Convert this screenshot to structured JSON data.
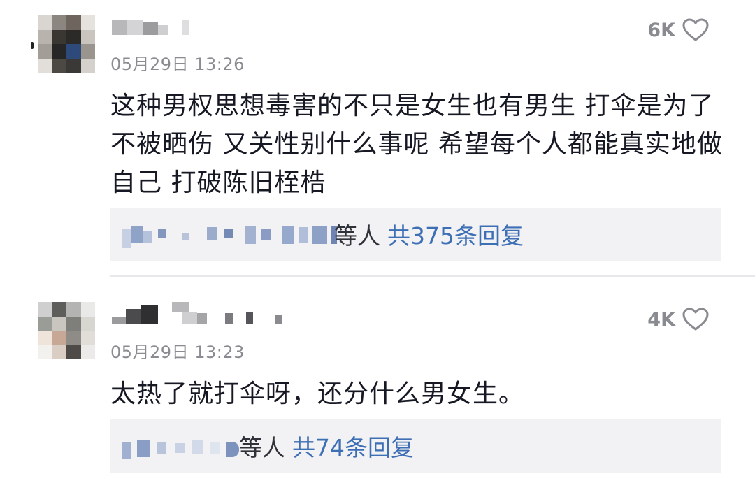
{
  "comments": [
    {
      "time": "05月29日 13:26",
      "likes": "6K",
      "text": "这种男权思想毒害的不只是女生也有男生 打伞是为了不被晒伤 又关性别什么事呢 希望每个人都能真实地做自己 打破陈旧桎梏",
      "reply_suffix": "等人",
      "reply_count": "共375条回复"
    },
    {
      "time": "05月29日 13:23",
      "likes": "4K",
      "text": "太热了就打伞呀，还分什么男女生。",
      "reply_suffix": "等人",
      "reply_count": "共74条回复"
    }
  ],
  "icons": {
    "like": "heart-outline-icon"
  },
  "colors": {
    "link": "#3d6fb4",
    "muted": "#8a8b91",
    "reply_bg": "#f2f2f4"
  }
}
